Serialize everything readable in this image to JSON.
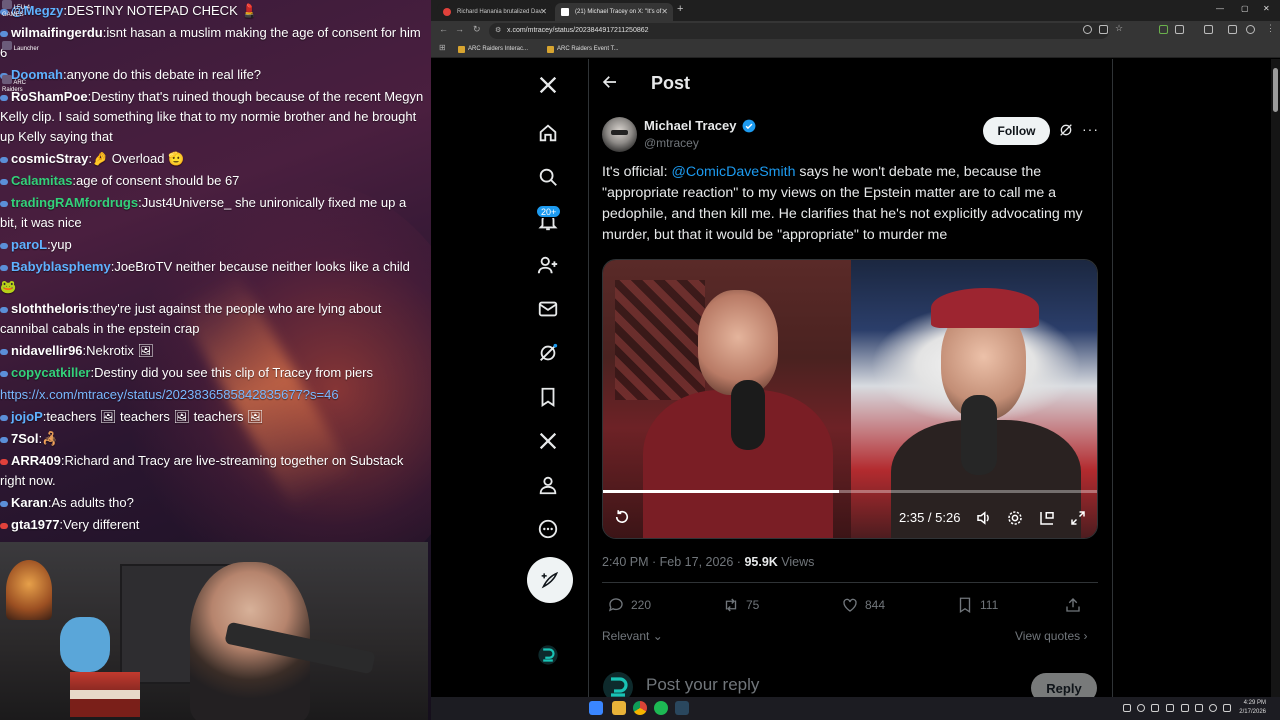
{
  "desktop": {
    "icons": [
      {
        "label": "LFU 4 GAMES",
        "name": "lfu-games"
      },
      {
        "label": "Launcher",
        "name": "launcher"
      },
      {
        "label": "ARC Raiders",
        "name": "arc-raiders"
      }
    ]
  },
  "chat": {
    "messages": [
      {
        "user": "@Megzy",
        "color": "blue",
        "badge": "blue",
        "text": "DESTINY NOTEPAD CHECK 💄",
        "sep": ":"
      },
      {
        "user": "wilmaifingerdu",
        "color": "white",
        "badge": "blue",
        "text": "isnt hasan a muslim making the age of consent for him 6",
        "sep": ":"
      },
      {
        "user": "Doomah",
        "color": "blue",
        "badge": "blue",
        "text": "anyone do this debate in real life?",
        "sep": ":"
      },
      {
        "user": "RoShamPoe",
        "color": "white",
        "badge": "blue",
        "text": "Destiny that's ruined though because of the recent Megyn Kelly clip. I said something like that to my normie brother and he brought up Kelly saying that",
        "sep": ":"
      },
      {
        "user": "cosmicStray",
        "color": "white",
        "badge": "blue",
        "text": "🤌 Overload 🫡",
        "sep": ":"
      },
      {
        "user": "Calamitas",
        "color": "green",
        "badge": "blue",
        "text": "age of consent should be 67",
        "sep": ":"
      },
      {
        "user": "tradingRAMfordrugs",
        "color": "green",
        "badge": "blue",
        "text": "Just4Universe_ she unironically fixed me up a bit, it was nice",
        "sep": ":"
      },
      {
        "user": "paroL",
        "color": "blue",
        "badge": "blue",
        "text": "yup",
        "sep": ":"
      },
      {
        "user": "Babyblasphemy",
        "color": "blue",
        "badge": "blue",
        "text": "JoeBroTV neither because neither looks like a child 🐸",
        "sep": ":"
      },
      {
        "user": "sloththeloris",
        "color": "white",
        "badge": "blue",
        "text": "they're just against the people who are lying about cannibal cabals in the epstein crap",
        "sep": ":"
      },
      {
        "user": "nidavellir96",
        "color": "white",
        "badge": "blue",
        "text": "Nekrotix 🖼",
        "sep": ":"
      },
      {
        "user": "copycatkiller",
        "color": "green",
        "badge": "blue",
        "text": "Destiny did you see this clip of Tracey from piers",
        "sep": ":"
      },
      {
        "user": "",
        "color": "blue",
        "badge": "",
        "text": "https://x.com/mtracey/status/2023836585842835677?s=46",
        "sep": "",
        "link": true
      },
      {
        "user": "jojoP",
        "color": "blue",
        "badge": "blue",
        "text": "teachers 🖼 teachers 🖼 teachers 🖼",
        "sep": ":"
      },
      {
        "user": "7Sol",
        "color": "white",
        "badge": "blue",
        "text": "🦂",
        "sep": ":"
      },
      {
        "user": "ARR409",
        "color": "white",
        "badge": "red",
        "text": "Richard and Tracy are live-streaming together on Substack right now.",
        "sep": ":"
      },
      {
        "user": "Karan",
        "color": "white",
        "badge": "blue",
        "text": "As adults tho?",
        "sep": ":"
      },
      {
        "user": "gta1977",
        "color": "white",
        "badge": "red",
        "text": "Very different",
        "sep": ":"
      }
    ]
  },
  "webcam": {
    "label": "streamer webcam"
  },
  "browser": {
    "tabs": [
      {
        "title": "Richard Hanania brutalized Dav",
        "active": false
      },
      {
        "title": "(21) Michael Tracey on X: \"It's of",
        "active": true
      }
    ],
    "url": "x.com/mtracey/status/2023844917211250862",
    "bookmarks": [
      "ARC Raiders Interac...",
      "ARC Raiders Event T..."
    ]
  },
  "x": {
    "notif_count": "20+",
    "nav_items": [
      "x-logo",
      "home",
      "explore",
      "notifications",
      "people",
      "messages",
      "grok",
      "bookmarks",
      "premium",
      "profile",
      "more"
    ],
    "header_title": "Post",
    "post": {
      "author_name": "Michael Tracey",
      "author_handle": "@mtracey",
      "follow_label": "Follow",
      "text_before": "It's official: ",
      "mention": "@ComicDaveSmith",
      "text_after": " says he won't debate me, because the \"appropriate reaction\" to my views on the Epstein matter are to call me a pedophile, and then kill me. He clarifies that he's not explicitly advocating my murder, but that it would be \"appropriate\" to murder me",
      "video_time": "2:35 / 5:26",
      "video_progress": 0.475,
      "timestamp": "2:40 PM · Feb 17, 2026 · ",
      "views_count": "95.9K",
      "views_label": " Views",
      "replies": "220",
      "reposts": "75",
      "likes": "844",
      "bookmarks": "111",
      "relevant_label": "Relevant",
      "view_quotes_label": "View quotes",
      "reply_placeholder": "Post your reply",
      "reply_button": "Reply"
    }
  },
  "taskbar": {
    "time": "4:29 PM",
    "date": "2/17/2026"
  },
  "colors": {
    "accent": "#1d9bf0",
    "text": "#e7e9ea",
    "muted": "#71767b"
  }
}
